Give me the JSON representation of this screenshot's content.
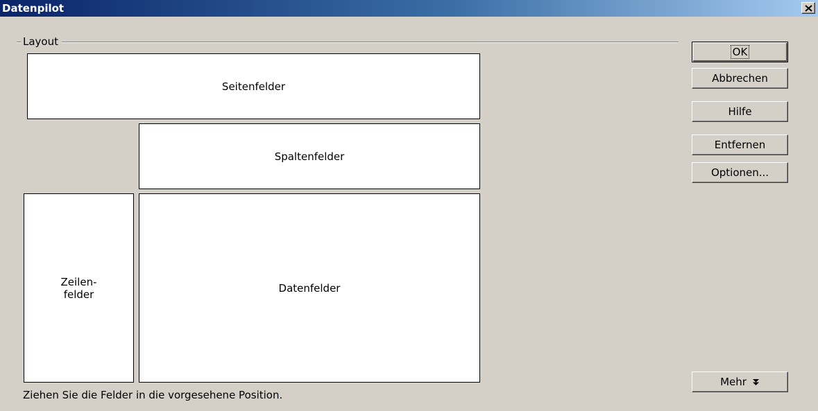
{
  "window": {
    "title": "Datenpilot",
    "close_icon": "close-icon"
  },
  "layout": {
    "group_label": "Layout",
    "page_fields": "Seitenfelder",
    "column_fields": "Spaltenfelder",
    "row_fields_line1": "Zeilen-",
    "row_fields_line2": "felder",
    "data_fields": "Datenfelder"
  },
  "buttons": {
    "ok": "OK",
    "cancel": "Abbrechen",
    "help": "Hilfe",
    "remove": "Entfernen",
    "options": "Optionen...",
    "more": "Mehr",
    "more_icon": "double-chevron-down-icon"
  },
  "hint": "Ziehen Sie die Felder in die vorgesehene Position."
}
